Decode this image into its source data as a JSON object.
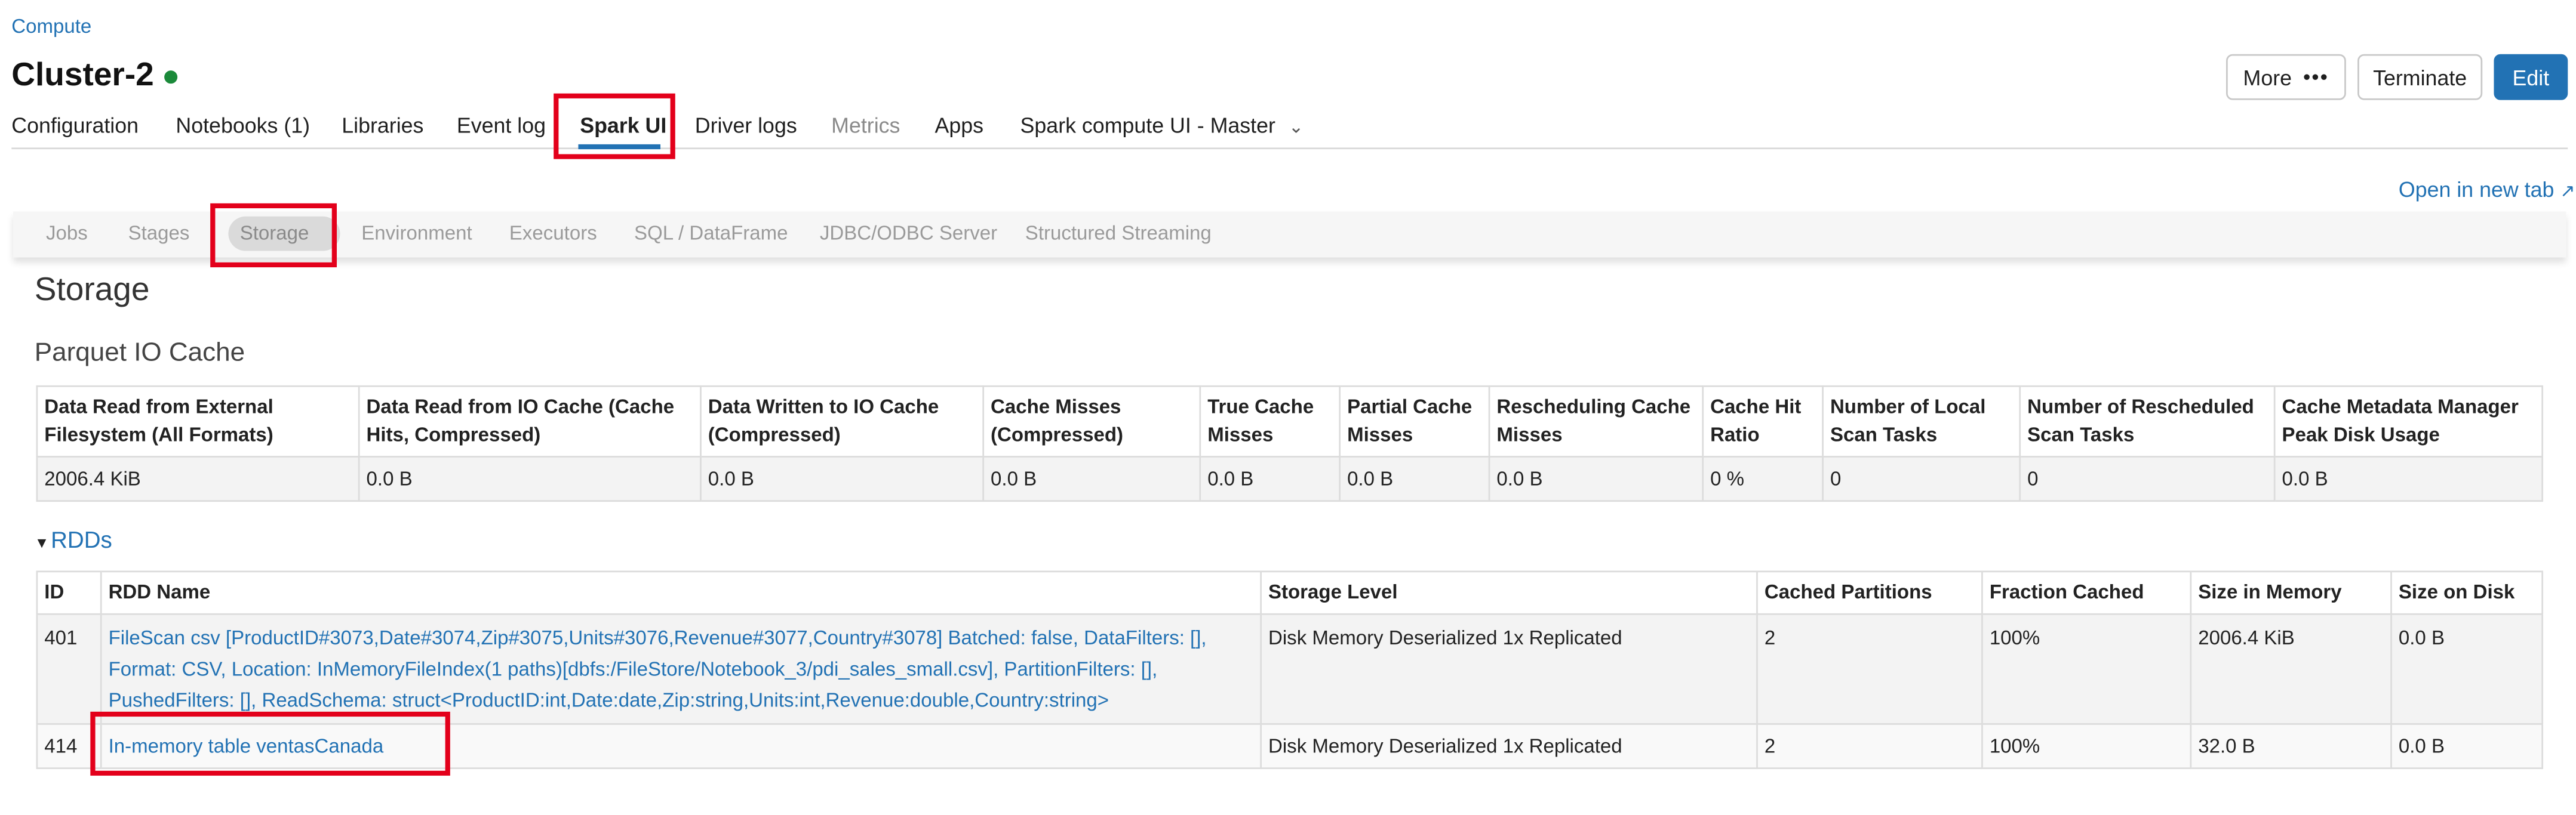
{
  "breadcrumb": "Compute",
  "cluster": {
    "name": "Cluster-2",
    "status_color": "#1b8a3a"
  },
  "actions": {
    "more_label": "More",
    "more_icon": "•••",
    "terminate_label": "Terminate",
    "edit_label": "Edit"
  },
  "tabs": [
    {
      "label": "Configuration"
    },
    {
      "label": "Notebooks (1)"
    },
    {
      "label": "Libraries"
    },
    {
      "label": "Event log"
    },
    {
      "label": "Spark UI"
    },
    {
      "label": "Driver logs"
    },
    {
      "label": "Metrics"
    },
    {
      "label": "Apps"
    },
    {
      "label": "Spark compute UI - Master"
    }
  ],
  "open_new_tab": "Open in new tab",
  "spark_tabs": [
    {
      "label": "Jobs"
    },
    {
      "label": "Stages"
    },
    {
      "label": "Storage"
    },
    {
      "label": "Environment"
    },
    {
      "label": "Executors"
    },
    {
      "label": "SQL / DataFrame"
    },
    {
      "label": "JDBC/ODBC Server"
    },
    {
      "label": "Structured Streaming"
    }
  ],
  "page_title": "Storage",
  "parquet_cache": {
    "title": "Parquet IO Cache",
    "headers": [
      "Data Read from External Filesystem (All Formats)",
      "Data Read from IO Cache (Cache Hits, Compressed)",
      "Data Written to IO Cache (Compressed)",
      "Cache Misses (Compressed)",
      "True Cache Misses",
      "Partial Cache Misses",
      "Rescheduling Cache Misses",
      "Cache Hit Ratio",
      "Number of Local Scan Tasks",
      "Number of Rescheduled Scan Tasks",
      "Cache Metadata Manager Peak Disk Usage"
    ],
    "values": [
      "2006.4 KiB",
      "0.0 B",
      "0.0 B",
      "0.0 B",
      "0.0 B",
      "0.0 B",
      "0.0 B",
      "0 %",
      "0",
      "0",
      "0.0 B"
    ]
  },
  "rdds": {
    "title": "RDDs",
    "headers": [
      "ID",
      "RDD Name",
      "Storage Level",
      "Cached Partitions",
      "Fraction Cached",
      "Size in Memory",
      "Size on Disk"
    ],
    "rows": [
      {
        "id": "401",
        "name": "FileScan csv [ProductID#3073,Date#3074,Zip#3075,Units#3076,Revenue#3077,Country#3078] Batched: false, DataFilters: [], Format: CSV, Location: InMemoryFileIndex(1 paths)[dbfs:/FileStore/Notebook_3/pdi_sales_small.csv], PartitionFilters: [], PushedFilters: [], ReadSchema: struct<ProductID:int,Date:date,Zip:string,Units:int,Revenue:double,Country:string>",
        "storage_level": "Disk Memory Deserialized 1x Replicated",
        "cached_partitions": "2",
        "fraction_cached": "100%",
        "size_in_memory": "2006.4 KiB",
        "size_on_disk": "0.0 B"
      },
      {
        "id": "414",
        "name": "In-memory table ventasCanada",
        "storage_level": "Disk Memory Deserialized 1x Replicated",
        "cached_partitions": "2",
        "fraction_cached": "100%",
        "size_in_memory": "32.0 B",
        "size_on_disk": "0.0 B"
      }
    ]
  }
}
